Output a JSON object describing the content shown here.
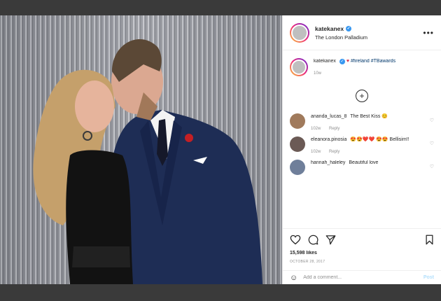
{
  "post": {
    "username": "katekanex",
    "location": "The London Palladium",
    "more_icon": "more-horizontal-icon",
    "verified_icon": "verified-badge-icon"
  },
  "caption": {
    "username": "katekanex",
    "tags": "#fireland #TBawards",
    "time": "10w"
  },
  "load_more_icon": "plus-circle-icon",
  "comments": [
    {
      "username": "ananda_lucas_8",
      "text": "The Best Kiss",
      "emoji": "😊",
      "time": "102w",
      "reply": "Reply",
      "avatar_color": "#a07a5c"
    },
    {
      "username": "eleanora.pinosia",
      "text": "Bellisim!!",
      "emoji": "😍😍❤️❤️ 😍😍",
      "time": "102w",
      "reply": "Reply",
      "avatar_color": "#6b5a55"
    },
    {
      "username": "hannah_haleley",
      "text": "Beautiful love",
      "emoji": "",
      "time": "",
      "reply": "",
      "avatar_color": "#6f7f9a"
    }
  ],
  "actions": {
    "like_icon": "heart-icon",
    "comment_icon": "comment-icon",
    "share_icon": "share-icon",
    "save_icon": "bookmark-icon",
    "likes": "15,598 likes",
    "date": "OCTOBER 28, 2017"
  },
  "add_comment": {
    "emoji_icon": "smile-icon",
    "placeholder": "Add a comment...",
    "post_label": "Post"
  }
}
